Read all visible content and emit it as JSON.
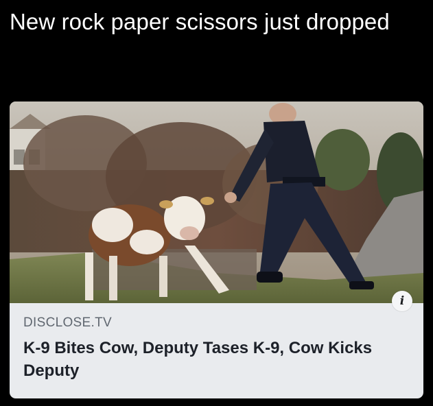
{
  "post": {
    "caption": "New rock paper scissors just dropped"
  },
  "link_card": {
    "image_alt": "Police deputy chasing a brown and white calf on a grassy slope",
    "info_icon_glyph": "i",
    "domain": "DISCLOSE.TV",
    "headline": "K-9 Bites Cow, Deputy Tases K-9, Cow Kicks Deputy"
  },
  "icons": {
    "info": "info-icon"
  },
  "colors": {
    "page_background": "#000000",
    "card_background": "#e9ebee",
    "domain_text": "#606770",
    "headline_text": "#1d2129"
  }
}
